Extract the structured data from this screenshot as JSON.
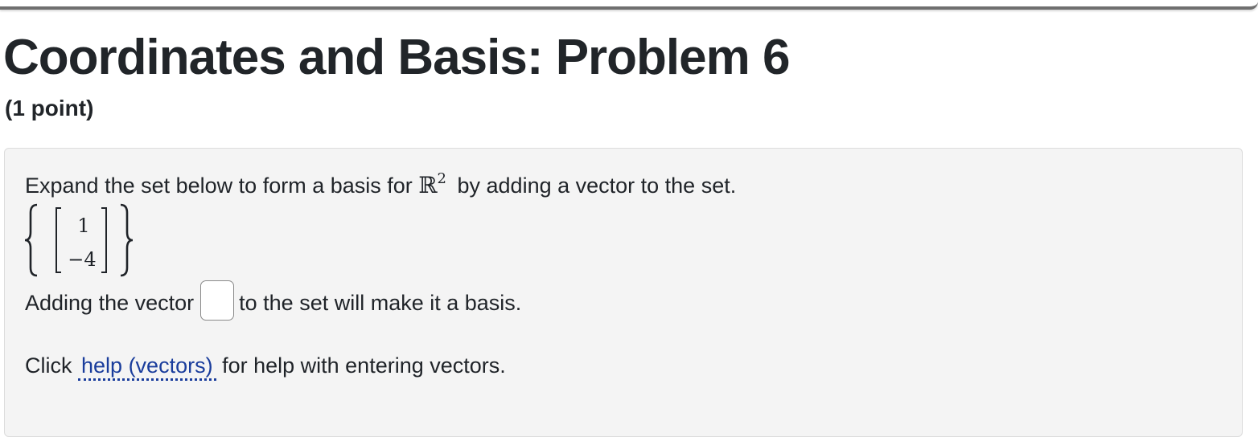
{
  "problem": {
    "title": "Coordinates and Basis: Problem 6",
    "points": "(1 point)"
  },
  "statement": {
    "prefix": "Expand the set below to form a basis for ",
    "space_symbol": "ℝ",
    "space_exponent": "2",
    "suffix": " by adding a vector to the set."
  },
  "vector_set": {
    "entries": [
      "1",
      "−4"
    ]
  },
  "answer_line": {
    "prefix": "Adding the vector",
    "suffix": "to the set will make it a basis.",
    "input_value": ""
  },
  "help_line": {
    "prefix": "Click",
    "link_label": "help (vectors)",
    "suffix": "for help with entering vectors."
  }
}
